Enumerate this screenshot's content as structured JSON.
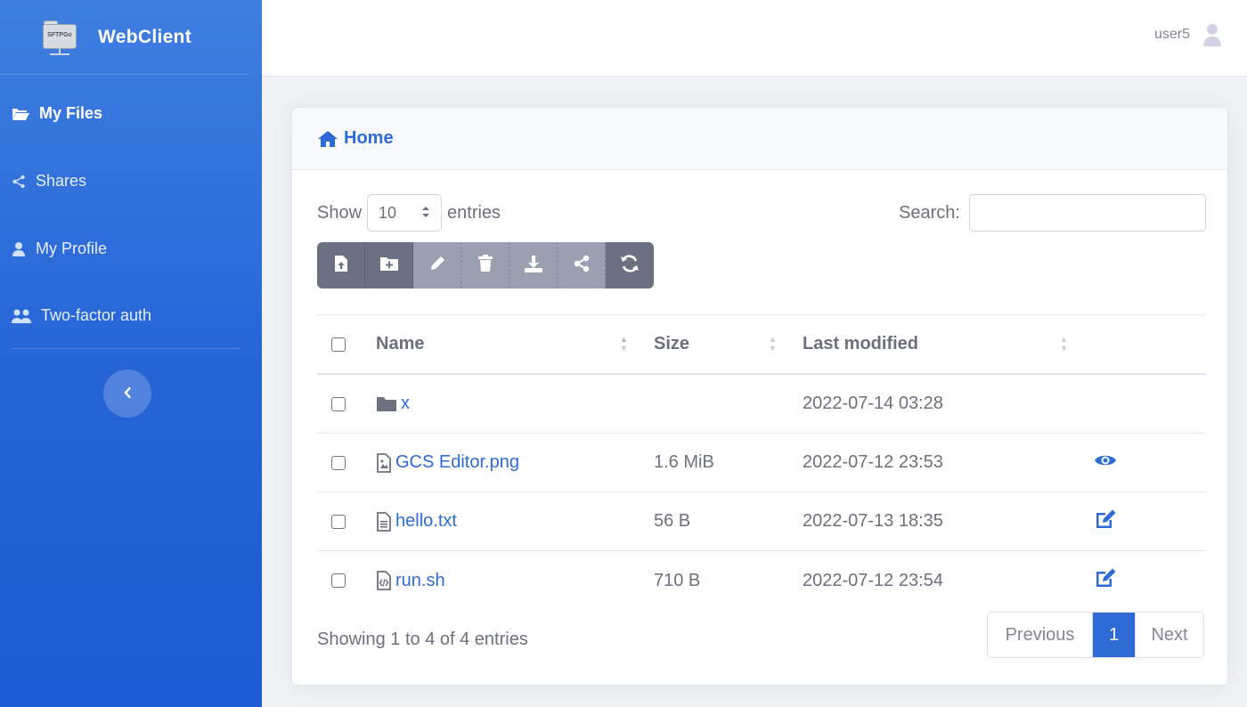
{
  "app": {
    "brand": "WebClient",
    "logo_text": "SFTPGo"
  },
  "sidebar": {
    "items": [
      {
        "label": "My Files",
        "icon": "folder-open-icon",
        "active": true
      },
      {
        "label": "Shares",
        "icon": "share-icon",
        "active": false
      },
      {
        "label": "My Profile",
        "icon": "user-icon",
        "active": false
      },
      {
        "label": "Two-factor auth",
        "icon": "users-icon",
        "active": false
      }
    ],
    "collapse_icon": "chevron-left-icon"
  },
  "topbar": {
    "username": "user5",
    "avatar_icon": "user-icon"
  },
  "breadcrumb": {
    "home_label": "Home",
    "icon": "home-icon"
  },
  "controls": {
    "show_label": "Show",
    "entries_label": "entries",
    "page_length": "10",
    "search_label": "Search:",
    "search_value": ""
  },
  "toolbar": [
    {
      "name": "upload-file-button",
      "icon": "file-upload-icon",
      "disabled": false
    },
    {
      "name": "create-folder-button",
      "icon": "folder-plus-icon",
      "disabled": false
    },
    {
      "name": "rename-button",
      "icon": "pencil-icon",
      "disabled": true
    },
    {
      "name": "delete-button",
      "icon": "trash-icon",
      "disabled": true
    },
    {
      "name": "download-button",
      "icon": "download-icon",
      "disabled": true
    },
    {
      "name": "share-button",
      "icon": "share-icon",
      "disabled": true
    },
    {
      "name": "refresh-button",
      "icon": "sync-icon",
      "disabled": false
    }
  ],
  "table": {
    "columns": [
      "Name",
      "Size",
      "Last modified"
    ],
    "rows": [
      {
        "name": "x",
        "type": "folder",
        "size": "",
        "modified": "2022-07-14 03:28",
        "action": ""
      },
      {
        "name": "GCS Editor.png",
        "type": "image",
        "size": "1.6 MiB",
        "modified": "2022-07-12 23:53",
        "action": "eye-icon"
      },
      {
        "name": "hello.txt",
        "type": "text",
        "size": "56 B",
        "modified": "2022-07-13 18:35",
        "action": "edit-icon"
      },
      {
        "name": "run.sh",
        "type": "code",
        "size": "710 B",
        "modified": "2022-07-12 23:54",
        "action": "edit-icon"
      }
    ]
  },
  "footer": {
    "info": "Showing 1 to 4 of 4 entries",
    "previous": "Previous",
    "current_page": "1",
    "next": "Next"
  },
  "colors": {
    "accent": "#2f6bd7",
    "sidebar": "#2563d6",
    "toolbar": "#6b7082"
  }
}
